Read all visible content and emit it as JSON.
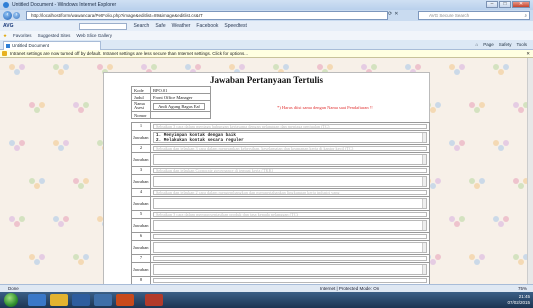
{
  "window": {
    "title": "Untitled Document - Windows Internet Explorer",
    "min": "–",
    "max": "□",
    "close": "✕"
  },
  "address": {
    "url": "http://localhost/form/wawancara/PetFolio.php?image&editlist=89&image&editlist.cs&IT",
    "search_placeholder": "AVG Secure Search"
  },
  "avg_toolbar": {
    "brand": "AVG",
    "items": [
      "Search",
      "Safe",
      "Weather",
      "Facebook",
      "Speedtest"
    ]
  },
  "favorites": {
    "label": "Favorites",
    "items": [
      "Suggested Sites",
      "Web Slice Gallery"
    ]
  },
  "tab": {
    "label": "Untitled Document"
  },
  "command_bar": {
    "items": [
      "Page",
      "Safety",
      "Tools"
    ]
  },
  "infobar": {
    "text": "Intranet settings are now turned off by default. Intranet settings are less secure than Internet settings. Click for options..."
  },
  "form": {
    "title": "Jawaban Pertanyaan Tertulis",
    "meta": [
      {
        "key": "Kode",
        "value": "BPO.01"
      },
      {
        "key": "Judul",
        "value": "Front Office Manager"
      },
      {
        "key": "Nama Asesi",
        "value": "Andi Agung Bagus Eaf"
      },
      {
        "key": "Nomor",
        "value": ""
      }
    ],
    "warning": "*) Harus diisi sama dengan Nama saat Pendaftaran !!",
    "questions": [
      {
        "no": "1",
        "prompt": "Sebutkan 3 cara dalam menjaga hubungan kerjasama dengan pelanggan dan menjaga penjualan (TC)",
        "answer_lines": [
          "1. Menyimpan kontak dengan baik",
          "2. Melakukan kontak secara reguler"
        ]
      },
      {
        "no": "2",
        "prompt": "Sebutkan dan jelaskan 3 cara dalam menerapkan kebersihan, keselamatan dan keamanan kerja di kantor kecil (TC)",
        "answer_lines": []
      },
      {
        "no": "3",
        "prompt": "Sebutkan dan jelaskan Corporate governance di tempat kerja (TKK)",
        "answer_lines": []
      },
      {
        "no": "4",
        "prompt": "Sebutkan dan jelaskan 2 cara dalam mengembangkan dan mempertahankan lingkungan kerja industri yang",
        "answer_lines": []
      },
      {
        "no": "5",
        "prompt": "Sebutkan 3 cara dalam memprosentasikan produk dan jasa kepada pelanggan (TC)",
        "answer_lines": []
      },
      {
        "no": "6",
        "prompt": "",
        "answer_lines": []
      },
      {
        "no": "7",
        "prompt": "",
        "answer_lines": []
      },
      {
        "no": "8",
        "prompt": "",
        "answer_lines": []
      }
    ],
    "answer_label": "Jawaban"
  },
  "status": {
    "left": "Done",
    "zone": "Internet | Protected Mode: On",
    "zoom": "75%"
  },
  "taskbar": {
    "clock": "21:45",
    "date": "07/02/2015"
  },
  "colors": {
    "accent": "#2f7fd6",
    "warning": "#e03030"
  }
}
